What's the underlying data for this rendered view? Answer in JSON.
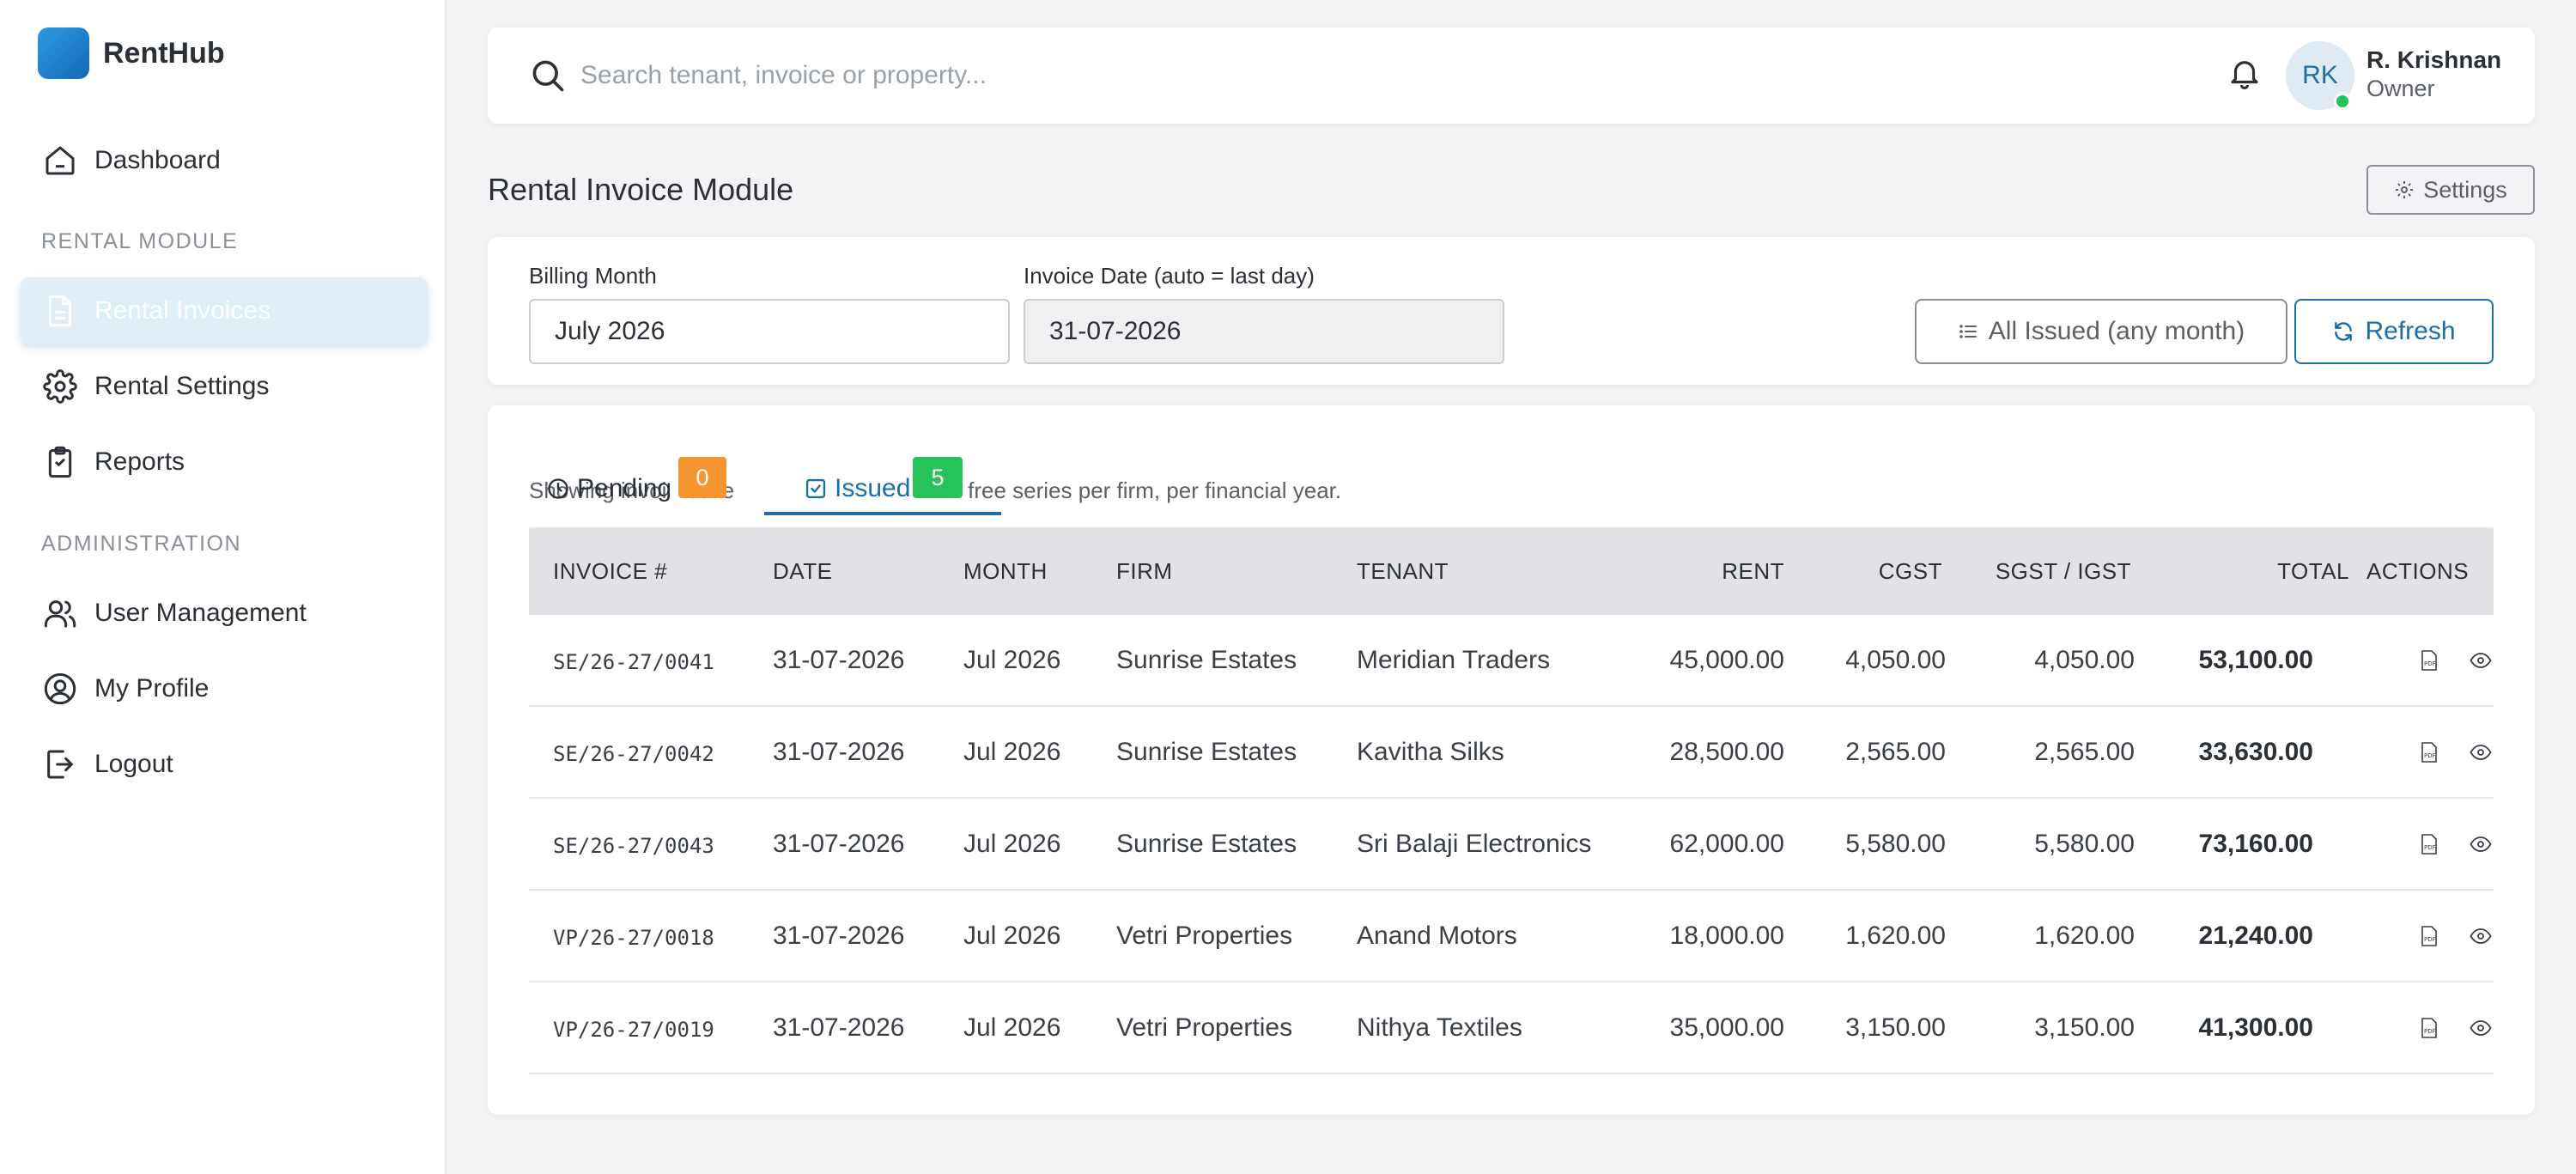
{
  "app": {
    "name": "RentHub"
  },
  "sidebar": {
    "dashboard": "Dashboard",
    "section_rental": "RENTAL MODULE",
    "rental_invoices": "Rental Invoices",
    "rental_settings": "Rental Settings",
    "reports": "Reports",
    "section_admin": "ADMINISTRATION",
    "user_management": "User Management",
    "my_profile": "My Profile",
    "logout": "Logout"
  },
  "topbar": {
    "search_placeholder": "Search tenant, invoice or property...",
    "user_initials": "RK",
    "user_name": "R. Krishnan",
    "user_role": "Owner"
  },
  "page": {
    "title": "Rental Invoice Module",
    "settings_label": "Settings"
  },
  "filters": {
    "billing_month_label": "Billing Month",
    "billing_month_value": "July 2026",
    "invoice_date_label": "Invoice Date (auto = last day)",
    "invoice_date_value": "31-07-2026",
    "all_issued_label": "All Issued (any month)",
    "refresh_label": "Refresh"
  },
  "tabs": {
    "showing_left": "Showing invoi",
    "showing_mid": "issue",
    "showing_right": "free series per firm, per financial year.",
    "pending_label": "Pending",
    "pending_count": "0",
    "issued_label": "Issued",
    "issued_count": "5"
  },
  "table": {
    "headers": [
      "INVOICE #",
      "DATE",
      "MONTH",
      "FIRM",
      "TENANT",
      "RENT",
      "CGST",
      "SGST / IGST",
      "TOTAL",
      "ACTIONS"
    ],
    "rows": [
      {
        "invoice": "SE/26-27/0041",
        "date": "31-07-2026",
        "month": "Jul 2026",
        "firm": "Sunrise Estates",
        "tenant": "Meridian Traders",
        "rent": "45,000.00",
        "cgst": "4,050.00",
        "sgst": "4,050.00",
        "total": "53,100.00"
      },
      {
        "invoice": "SE/26-27/0042",
        "date": "31-07-2026",
        "month": "Jul 2026",
        "firm": "Sunrise Estates",
        "tenant": "Kavitha Silks",
        "rent": "28,500.00",
        "cgst": "2,565.00",
        "sgst": "2,565.00",
        "total": "33,630.00"
      },
      {
        "invoice": "SE/26-27/0043",
        "date": "31-07-2026",
        "month": "Jul 2026",
        "firm": "Sunrise Estates",
        "tenant": "Sri Balaji Electronics",
        "rent": "62,000.00",
        "cgst": "5,580.00",
        "sgst": "5,580.00",
        "total": "73,160.00"
      },
      {
        "invoice": "VP/26-27/0018",
        "date": "31-07-2026",
        "month": "Jul 2026",
        "firm": "Vetri Properties",
        "tenant": "Anand Motors",
        "rent": "18,000.00",
        "cgst": "1,620.00",
        "sgst": "1,620.00",
        "total": "21,240.00"
      },
      {
        "invoice": "VP/26-27/0019",
        "date": "31-07-2026",
        "month": "Jul 2026",
        "firm": "Vetri Properties",
        "tenant": "Nithya Textiles",
        "rent": "35,000.00",
        "cgst": "3,150.00",
        "sgst": "3,150.00",
        "total": "41,300.00"
      }
    ]
  },
  "colors": {
    "accent": "#1b6fa8",
    "pending_badge": "#f5952f",
    "issued_badge": "#27c25a",
    "active_nav_bg": "#dfeef7"
  },
  "icons": {
    "row_actions": [
      "pdf-icon",
      "eye-icon"
    ]
  }
}
